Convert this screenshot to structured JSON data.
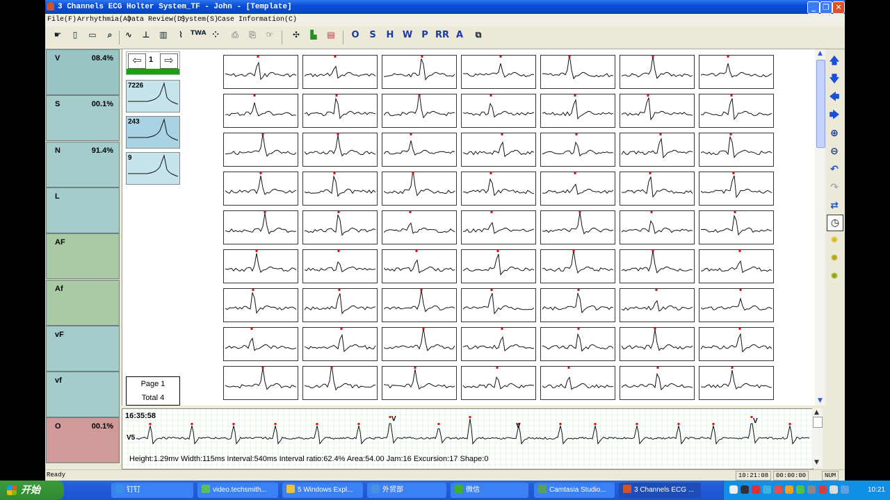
{
  "window": {
    "title": "3 Channels ECG Holter System_TF - John - [Template]",
    "controls": {
      "minimize": "_",
      "restore": "❐",
      "close": "✕"
    }
  },
  "menu": [
    "File(F)",
    "Arrhythmia(A)",
    "Data Review(D)",
    "System(S)",
    "Case Information(C)"
  ],
  "toolbar": {
    "icons": [
      "hand-icon",
      "new-file-icon",
      "open-folder-icon",
      "search-icon",
      "waveform-icon",
      "ecg-analysis-icon",
      "histogram-icon",
      "ecg-beat-icon",
      "twa-icon",
      "scatter-icon",
      "print-icon",
      "print-preview-icon",
      "pointer-hand-icon",
      "grid-tool-icon",
      "chart-tool-icon",
      "spectrum-tool-icon"
    ],
    "twa_label": "TWA",
    "letter_buttons": [
      "O",
      "S",
      "H",
      "W",
      "P",
      "RR",
      "A"
    ]
  },
  "categories": [
    {
      "name": "V",
      "percent": "08.4%",
      "color": "#99c5c4"
    },
    {
      "name": "S",
      "percent": "00.1%",
      "color": "#a3ccca"
    },
    {
      "name": "N",
      "percent": "91.4%",
      "color": "#a3ccca"
    },
    {
      "name": "L",
      "percent": "",
      "color": "#a3ccca"
    },
    {
      "name": "AF",
      "percent": "",
      "color": "#a8c9a4"
    },
    {
      "name": "Af",
      "percent": "",
      "color": "#a8c9a4"
    },
    {
      "name": "vF",
      "percent": "",
      "color": "#a3ccca"
    },
    {
      "name": "vf",
      "percent": "",
      "color": "#a3ccca"
    },
    {
      "name": "O",
      "percent": "00.1%",
      "color": "#d19a9a"
    }
  ],
  "template_nav": {
    "prev": "⇦",
    "next": "⇨",
    "index": "1"
  },
  "templates": [
    {
      "count": "7226",
      "color": "#c6e4ec"
    },
    {
      "count": "243",
      "color": "#a9d3e4"
    },
    {
      "count": "9",
      "color": "#c6e4ec"
    }
  ],
  "pagination": {
    "page": "Page 1",
    "total": "Total 4"
  },
  "grid": {
    "rows": 9,
    "cols": 7
  },
  "rhythm_strip": {
    "time": "16:35:58",
    "lead": "V5",
    "beat_labels": [
      "V",
      "V",
      "V"
    ],
    "measurements": "Height:1.29mv  Width:115ms  Interval:540ms  Interval ratio:62.4%  Area:54.00  Jam:16  Excursion:17  Shape:0"
  },
  "status": {
    "left": "Ready",
    "time": "10:21:08",
    "elapsed": "00:00:00",
    "mode": "NUM"
  },
  "taskbar": {
    "start": "开始",
    "tasks": [
      {
        "label": "钉钉",
        "color": "#3a8ee6"
      },
      {
        "label": "video.techsmith...",
        "color": "#5fbf5f"
      },
      {
        "label": "5 Windows Expl...",
        "color": "#f0c040"
      },
      {
        "label": "外贸部",
        "color": "#4a90e2"
      },
      {
        "label": "微信",
        "color": "#3cb034"
      },
      {
        "label": "Camtasia Studio...",
        "color": "#5aa05a"
      },
      {
        "label": "3 Channels ECG ...",
        "color": "#d2522a"
      }
    ],
    "clock": "10:21"
  }
}
